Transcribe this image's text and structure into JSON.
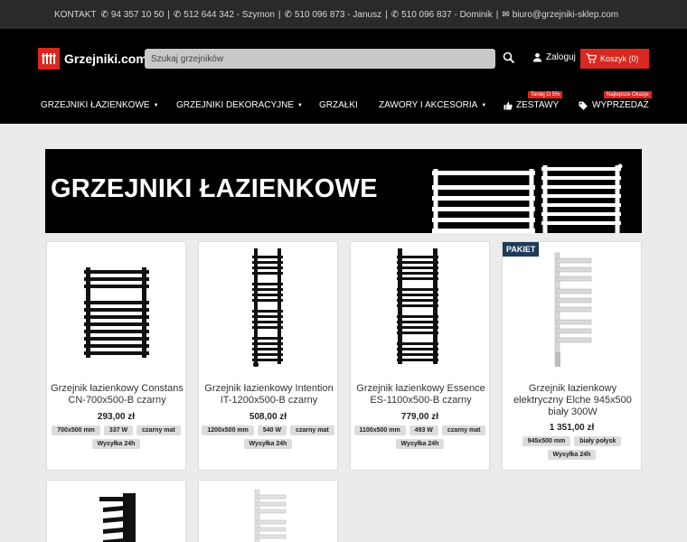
{
  "topbar": {
    "kontakt": "KONTAKT",
    "phone1": "94 357 10 50",
    "phone2": "512 644 342 - Szymon",
    "phone3": "510 096 873 - Janusz",
    "phone4": "510 096 837 - Dominik",
    "email": "biuro@grzejniki-sklep.com"
  },
  "header": {
    "logo_text": "Grzejniki.com",
    "search_placeholder": "Szukaj grzejników",
    "login_label": "Zaloguj",
    "cart_label": "Koszyk (0)"
  },
  "nav": {
    "items": [
      {
        "label": "GRZEJNIKI ŁAZIENKOWE"
      },
      {
        "label": "GRZEJNIKI DEKORACYJNE"
      },
      {
        "label": "GRZAŁKI"
      },
      {
        "label": "ZAWORY I AKCESORIA"
      },
      {
        "label": "ZESTAWY",
        "badge": "Taniej O 5%"
      },
      {
        "label": "WYPRZEDAŻ",
        "badge": "Najlepsze Okazje"
      }
    ]
  },
  "banner": {
    "title": "GRZEJNIKI ŁAZIENKOWE"
  },
  "products": [
    {
      "name": "Grzejnik łazienkowy Constans CN-700x500-B czarny",
      "price": "293,00 zł",
      "tags": [
        "700x500 mm",
        "337 W",
        "czarny mat",
        "Wysyłka 24h"
      ]
    },
    {
      "name": "Grzejnik łazienkowy Intention IT-1200x500-B czarny",
      "price": "508,00 zł",
      "tags": [
        "1200x500 mm",
        "540 W",
        "czarny mat",
        "Wysyłka 24h"
      ]
    },
    {
      "name": "Grzejnik łazienkowy Essence ES-1100x500-B czarny",
      "price": "779,00 zł",
      "tags": [
        "1100x500 mm",
        "493 W",
        "czarny mat",
        "Wysyłka 24h"
      ]
    },
    {
      "name": "Grzejnik łazienkowy elektryczny Elche 945x500 biały 300W",
      "price": "1 351,00 zł",
      "tags": [
        "945x500 mm",
        "biały połysk",
        "Wysyłka 24h"
      ],
      "badge": "PAKIET"
    }
  ],
  "colors": {
    "accent": "#d9281f",
    "badge": "#1d3b58"
  }
}
